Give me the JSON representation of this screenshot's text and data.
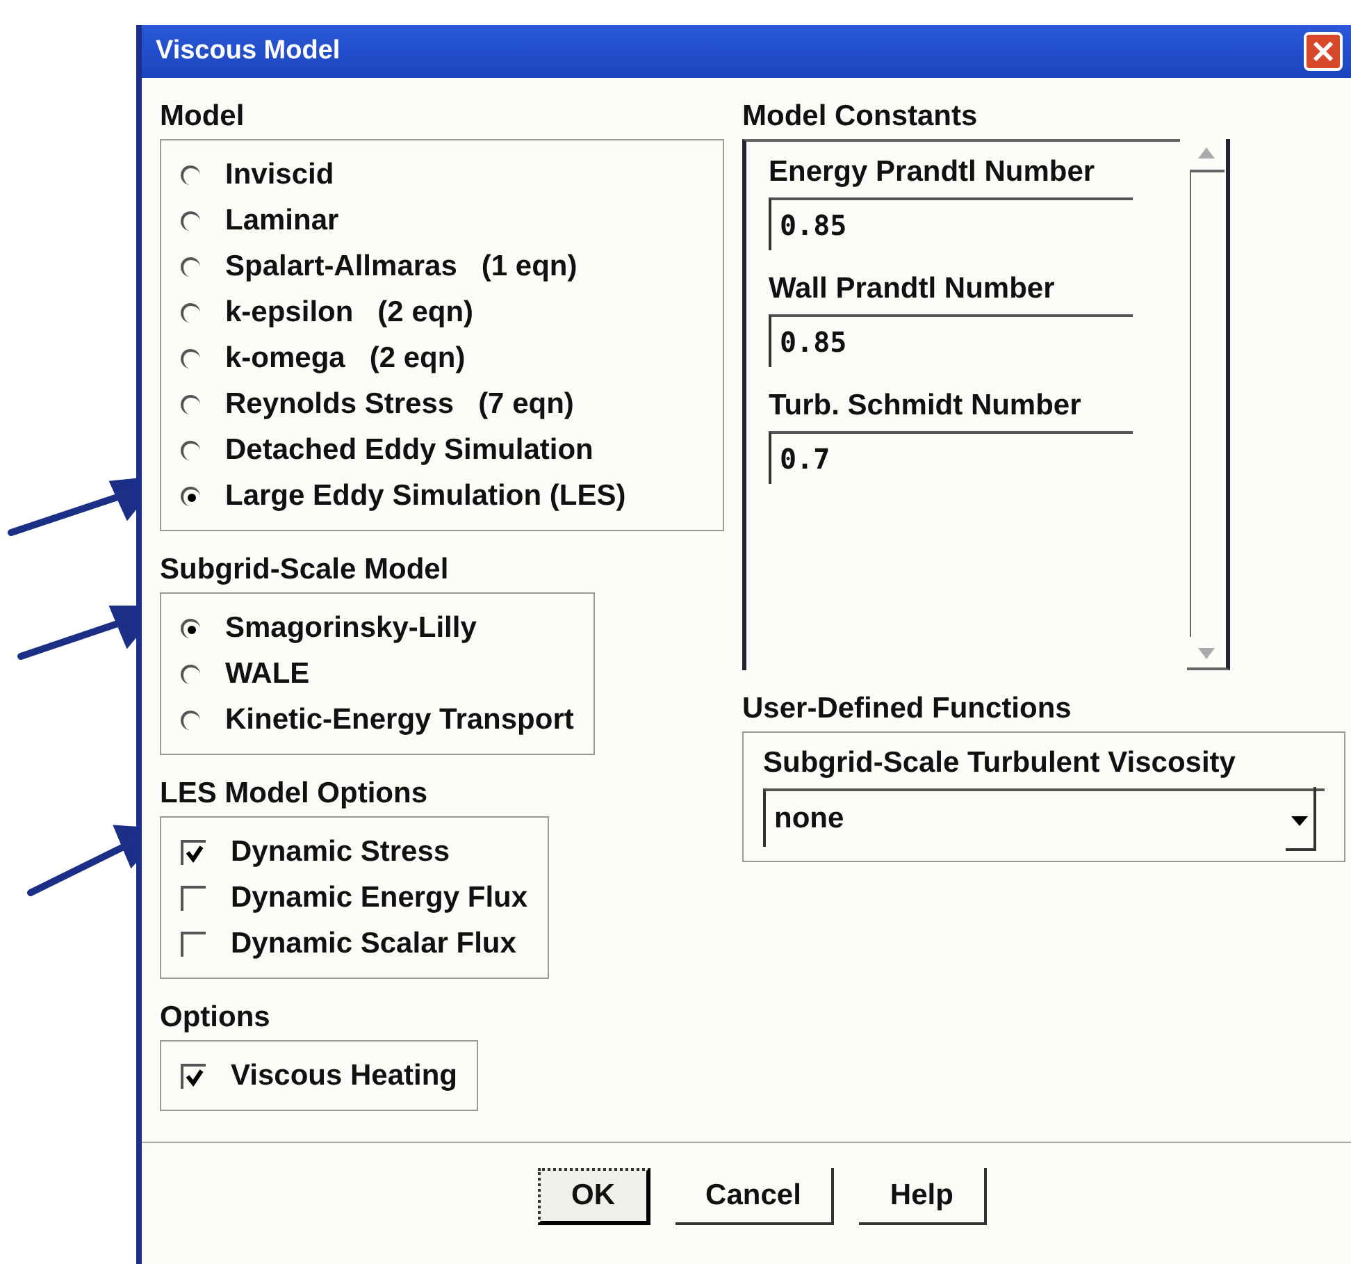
{
  "window": {
    "title": "Viscous Model"
  },
  "model": {
    "title": "Model",
    "options": [
      {
        "label": "Inviscid",
        "selected": false
      },
      {
        "label": "Laminar",
        "selected": false
      },
      {
        "label": "Spalart-Allmaras   (1 eqn)",
        "selected": false
      },
      {
        "label": "k-epsilon   (2 eqn)",
        "selected": false
      },
      {
        "label": "k-omega   (2 eqn)",
        "selected": false
      },
      {
        "label": "Reynolds Stress   (7 eqn)",
        "selected": false
      },
      {
        "label": "Detached Eddy Simulation",
        "selected": false
      },
      {
        "label": "Large Eddy Simulation (LES)",
        "selected": true
      }
    ]
  },
  "subgrid_scale_model": {
    "title": "Subgrid-Scale Model",
    "options": [
      {
        "label": "Smagorinsky-Lilly",
        "selected": true
      },
      {
        "label": "WALE",
        "selected": false
      },
      {
        "label": "Kinetic-Energy Transport",
        "selected": false
      }
    ]
  },
  "les_model_options": {
    "title": "LES Model Options",
    "options": [
      {
        "label": "Dynamic Stress",
        "checked": true
      },
      {
        "label": "Dynamic Energy Flux",
        "checked": false
      },
      {
        "label": "Dynamic Scalar Flux",
        "checked": false
      }
    ]
  },
  "options": {
    "title": "Options",
    "options": [
      {
        "label": "Viscous Heating",
        "checked": true
      }
    ]
  },
  "model_constants": {
    "title": "Model Constants",
    "fields": [
      {
        "label": "Energy Prandtl Number",
        "value": "0.85"
      },
      {
        "label": "Wall Prandtl Number",
        "value": "0.85"
      },
      {
        "label": "Turb. Schmidt Number",
        "value": "0.7"
      }
    ]
  },
  "user_defined_functions": {
    "title": "User-Defined Functions",
    "label": "Subgrid-Scale Turbulent Viscosity",
    "value": "none"
  },
  "buttons": [
    {
      "label": "OK",
      "focused": true
    },
    {
      "label": "Cancel",
      "focused": false
    },
    {
      "label": "Help",
      "focused": false
    }
  ]
}
